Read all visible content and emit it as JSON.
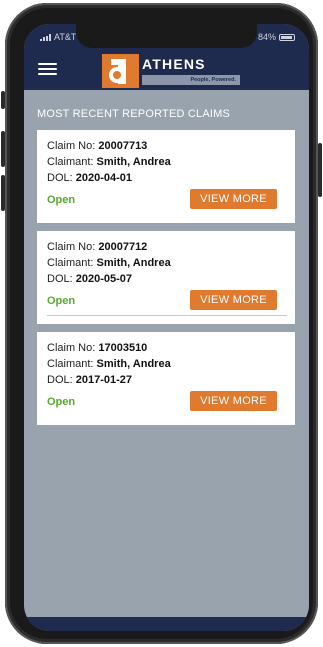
{
  "status_bar": {
    "carrier": "AT&T",
    "battery": "84%"
  },
  "header": {
    "brand": "ATHENS",
    "tagline": "People, Powered."
  },
  "main": {
    "section_title": "MOST RECENT REPORTED CLAIMS",
    "claims": [
      {
        "claim_no_label": "Claim No:",
        "claim_no": "20007713",
        "claimant_label": "Claimant:",
        "claimant": "Smith, Andrea",
        "dol_label": "DOL:",
        "dol": "2020-04-01",
        "status": "Open",
        "button_label": "VIEW MORE"
      },
      {
        "claim_no_label": "Claim No:",
        "claim_no": "20007712",
        "claimant_label": "Claimant:",
        "claimant": "Smith, Andrea",
        "dol_label": "DOL:",
        "dol": "2020-05-07",
        "status": "Open",
        "button_label": "VIEW MORE"
      },
      {
        "claim_no_label": "Claim No:",
        "claim_no": "17003510",
        "claimant_label": "Claimant:",
        "claimant": "Smith, Andrea",
        "dol_label": "DOL:",
        "dol": "2017-01-27",
        "status": "Open",
        "button_label": "VIEW MORE"
      }
    ]
  },
  "colors": {
    "header_bg": "#1f2a4f",
    "screen_bg": "#98a3ad",
    "accent": "#e07a2f",
    "status_open": "#5aa832"
  },
  "icons": {
    "menu": "hamburger-icon",
    "logo": "athens-logo-icon"
  }
}
